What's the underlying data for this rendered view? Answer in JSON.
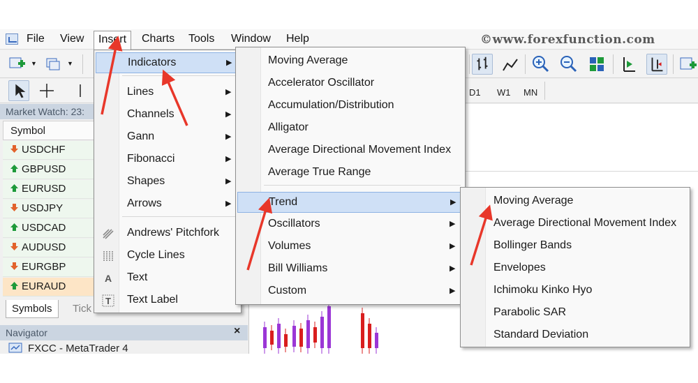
{
  "watermark": "©www.forexfunction.com",
  "menubar": {
    "items": [
      "File",
      "View",
      "Insert",
      "Charts",
      "Tools",
      "Window",
      "Help"
    ],
    "active": "Insert"
  },
  "timeframes": [
    "D1",
    "W1",
    "MN"
  ],
  "market_watch": {
    "title": "Market Watch: 23:",
    "column": "Symbol",
    "rows": [
      {
        "symbol": "USDCHF",
        "dir": "down"
      },
      {
        "symbol": "GBPUSD",
        "dir": "up"
      },
      {
        "symbol": "EURUSD",
        "dir": "up"
      },
      {
        "symbol": "USDJPY",
        "dir": "down"
      },
      {
        "symbol": "USDCAD",
        "dir": "up"
      },
      {
        "symbol": "AUDUSD",
        "dir": "down"
      },
      {
        "symbol": "EURGBP",
        "dir": "down"
      },
      {
        "symbol": "EURAUD",
        "dir": "up"
      }
    ],
    "selected": "EURAUD",
    "tabs": [
      "Symbols",
      "Tick"
    ]
  },
  "navigator": {
    "title": "Navigator",
    "close": "×",
    "item": "FXCC - MetaTrader 4"
  },
  "insert_menu": {
    "items": [
      {
        "label": "Indicators",
        "submenu": true,
        "highlighted": true
      },
      {
        "label": "Lines",
        "submenu": true
      },
      {
        "label": "Channels",
        "submenu": true
      },
      {
        "label": "Gann",
        "submenu": true
      },
      {
        "label": "Fibonacci",
        "submenu": true
      },
      {
        "label": "Shapes",
        "submenu": true
      },
      {
        "label": "Arrows",
        "submenu": true
      },
      {
        "label": "Andrews' Pitchfork",
        "icon": "pitchfork-icon"
      },
      {
        "label": "Cycle Lines",
        "icon": "cycle-lines-icon"
      },
      {
        "label": "Text",
        "icon": "text-icon"
      },
      {
        "label": "Text Label",
        "icon": "text-label-icon"
      }
    ]
  },
  "indicators_menu": {
    "items": [
      {
        "label": "Moving Average"
      },
      {
        "label": "Accelerator Oscillator"
      },
      {
        "label": "Accumulation/Distribution"
      },
      {
        "label": "Alligator"
      },
      {
        "label": "Average Directional Movement Index"
      },
      {
        "label": "Average True Range"
      },
      {
        "label": "Trend",
        "submenu": true,
        "highlighted": true
      },
      {
        "label": "Oscillators",
        "submenu": true
      },
      {
        "label": "Volumes",
        "submenu": true
      },
      {
        "label": "Bill Williams",
        "submenu": true
      },
      {
        "label": "Custom",
        "submenu": true
      }
    ]
  },
  "trend_menu": {
    "items": [
      "Moving Average",
      "Average Directional Movement Index",
      "Bollinger Bands",
      "Envelopes",
      "Ichimoku Kinko Hyo",
      "Parabolic SAR",
      "Standard Deviation"
    ]
  },
  "colors": {
    "menu_highlight": "#cfe0f6",
    "annotation_arrow": "#e8372a",
    "up_arrow": "#1e9a3a",
    "down_arrow": "#e2622b",
    "selected_row": "#fde5c6",
    "candle_up": "#9b36d6",
    "candle_down": "#d91e1e"
  }
}
